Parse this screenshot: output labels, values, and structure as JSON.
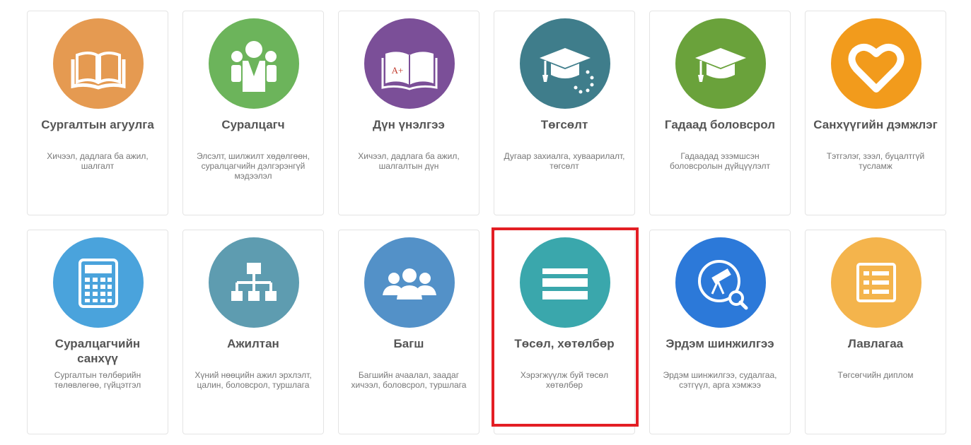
{
  "cards": [
    {
      "title": "Сургалтын агуулга",
      "desc": "Хичээл, дадлага ба ажил, шалгалт",
      "color": "#e59a51",
      "icon": "book-icon"
    },
    {
      "title": "Суралцагч",
      "desc": "Элсэлт, шилжилт хөдөлгөөн, суралцагчийн дэлгэрэнгүй мэдээлэл",
      "color": "#6cb45b",
      "icon": "students-icon"
    },
    {
      "title": "Дүн үнэлгээ",
      "desc": "Хичээл, дадлага ба ажил, шалгалтын дүн",
      "color": "#7b4f98",
      "icon": "grade-book-icon",
      "badge": "A+"
    },
    {
      "title": "Төгсөлт",
      "desc": "Дугаар захиалга, хуваарилалт, төгсөлт",
      "color": "#3f7d8b",
      "icon": "graduation-cap-loading-icon"
    },
    {
      "title": "Гадаад боловсрол",
      "desc": "Гадаадад эзэмшсэн боловсролын дүйцүүлэлт",
      "color": "#6aa23b",
      "icon": "graduation-cap-icon"
    },
    {
      "title": "Санхүүгийн дэмжлэг",
      "desc": "Тэтгэлэг, зээл, буцалтгүй тусламж",
      "color": "#f29b1c",
      "icon": "heart-icon"
    },
    {
      "title": "Суралцагчийн санхүү",
      "desc": "Сургалтын төлбөрийн төлөвлөгөө, гүйцэтгэл",
      "color": "#4aa3dc",
      "icon": "calculator-icon"
    },
    {
      "title": "Ажилтан",
      "desc": "Хүний нөөцийн ажил эрхлэлт, цалин, боловсрол, туршлага",
      "color": "#5e9cb0",
      "icon": "org-chart-icon"
    },
    {
      "title": "Багш",
      "desc": "Багшийн ачаалал, заадаг хичээл, боловсрол, туршлага",
      "color": "#5391c8",
      "icon": "teachers-group-icon"
    },
    {
      "title": "Төсөл, хөтөлбөр",
      "desc": "Хэрэгжүүлж буй төсөл хөтөлбөр",
      "color": "#3aa7ac",
      "icon": "server-list-icon"
    },
    {
      "title": "Эрдэм шинжилгээ",
      "desc": "Эрдэм шинжилгээ, судалгаа, сэтгүүл, арга хэмжээ",
      "color": "#2c79d9",
      "icon": "telescope-search-icon"
    },
    {
      "title": "Лавлагаа",
      "desc": "Төгсөгчийн диплом",
      "color": "#f4b44c",
      "icon": "reference-list-icon"
    }
  ],
  "highlight": {
    "target": "Төсөл, хөтөлбөр",
    "color": "#e31e24"
  }
}
